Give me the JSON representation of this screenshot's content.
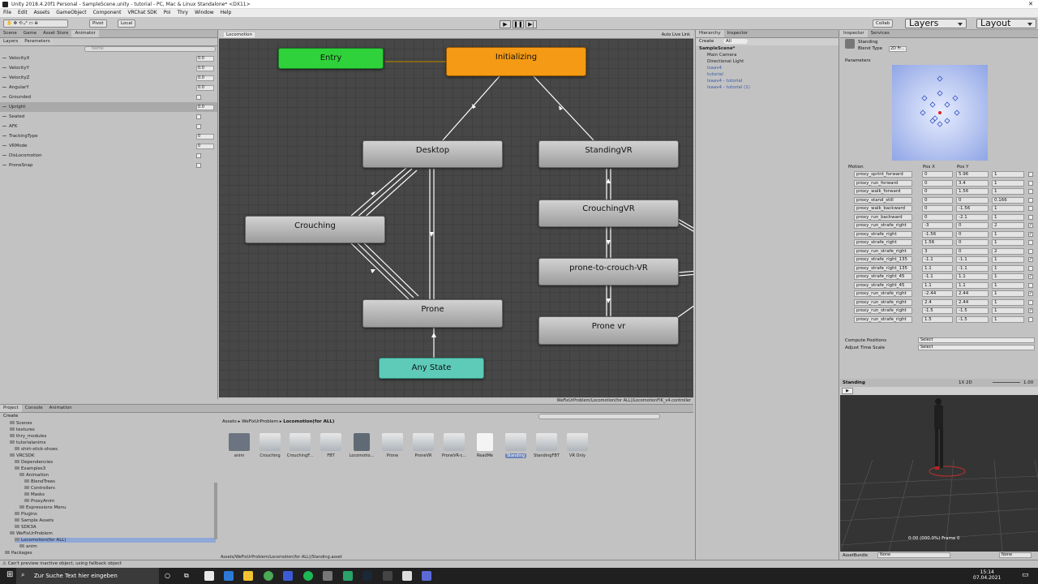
{
  "window": {
    "title": "Unity 2018.4.20f1 Personal - SampleScene.unity - tutorial - PC, Mac & Linux Standalone* <DX11>"
  },
  "menu": [
    "File",
    "Edit",
    "Assets",
    "GameObject",
    "Component",
    "VRChat SDK",
    "Poi",
    "Thry",
    "Window",
    "Help"
  ],
  "toolbar": {
    "pivot": "Pivot",
    "local": "Local",
    "collab": "Collab",
    "layers": "Layers",
    "layout": "Layout"
  },
  "left_tabs": [
    "Scene",
    "Game",
    "Asset Store",
    "Animator"
  ],
  "animator_subtabs": [
    "Layers",
    "Parameters"
  ],
  "search_placeholder": "Name",
  "parameters": [
    {
      "name": "VelocityX",
      "value": "0.0",
      "type": "float"
    },
    {
      "name": "VelocityY",
      "value": "0.0",
      "type": "float"
    },
    {
      "name": "VelocityZ",
      "value": "0.0",
      "type": "float"
    },
    {
      "name": "AngularY",
      "value": "0.0",
      "type": "float"
    },
    {
      "name": "Grounded",
      "value": "",
      "type": "bool"
    },
    {
      "name": "Upright",
      "value": "0.0",
      "type": "float"
    },
    {
      "name": "Seated",
      "value": "",
      "type": "bool"
    },
    {
      "name": "AFK",
      "value": "",
      "type": "bool"
    },
    {
      "name": "TrackingType",
      "value": "0",
      "type": "int"
    },
    {
      "name": "VRMode",
      "value": "0",
      "type": "int"
    },
    {
      "name": "DisLocomotion",
      "value": "",
      "type": "bool"
    },
    {
      "name": "ProneSnap",
      "value": "",
      "type": "bool"
    }
  ],
  "graph": {
    "breadcrumb": "Locomotion",
    "auto_live": "Auto Live Link",
    "path": "WeFixUrProblem/Locomotion(for ALL)/LocomotionFIK_v4.controller",
    "nodes": {
      "entry": "Entry",
      "initializing": "Initializing",
      "desktop": "Desktop",
      "standingvr": "StandingVR",
      "crouching": "Crouching",
      "crouchingvr": "CrouchingVR",
      "prone_to_crouch": "prone-to-crouch-VR",
      "prone": "Prone",
      "prone_vr": "Prone vr",
      "any_state": "Any State"
    }
  },
  "project": {
    "tabs": [
      "Project",
      "Console",
      "Animation"
    ],
    "create": "Create",
    "breadcrumb": [
      "Assets",
      "WeFixUrProblem",
      "Locomotion(for ALL)"
    ],
    "tree": [
      {
        "label": "Scenes",
        "indent": 2
      },
      {
        "label": "textures",
        "indent": 2
      },
      {
        "label": "thry_modules",
        "indent": 2
      },
      {
        "label": "tutorialanims",
        "indent": 2
      },
      {
        "label": "shirt-stick-shoes",
        "indent": 3
      },
      {
        "label": "VRCSDK",
        "indent": 2
      },
      {
        "label": "Dependencies",
        "indent": 3
      },
      {
        "label": "Examples3",
        "indent": 3
      },
      {
        "label": "Animation",
        "indent": 4
      },
      {
        "label": "BlendTrees",
        "indent": 5
      },
      {
        "label": "Controllers",
        "indent": 5
      },
      {
        "label": "Masks",
        "indent": 5
      },
      {
        "label": "ProxyAnim",
        "indent": 5
      },
      {
        "label": "Expressions Menu",
        "indent": 4
      },
      {
        "label": "Plugins",
        "indent": 3
      },
      {
        "label": "Sample Assets",
        "indent": 3
      },
      {
        "label": "SDK3A",
        "indent": 3
      },
      {
        "label": "WeFixUrProblem",
        "indent": 2
      },
      {
        "label": "Locomotion(for ALL)",
        "indent": 3
      },
      {
        "label": "anim",
        "indent": 4
      },
      {
        "label": "Packages",
        "indent": 1
      }
    ],
    "assets": [
      "anim",
      "Crouching",
      "CrouchingF...",
      "FBT",
      "Locomotio...",
      "Prone",
      "ProneVR",
      "ProneVR-c...",
      "ReadMe",
      "Standing",
      "StandingFBT",
      "VR Only"
    ],
    "selected_path": "Assets/WeFixUrProblem/Locomotion(for ALL)/Standing.asset"
  },
  "hierarchy": {
    "tab": "Hierarchy",
    "create": "Create",
    "all": "All",
    "items": [
      {
        "label": "SampleScene*",
        "indent": 0
      },
      {
        "label": "Main Camera",
        "indent": 1
      },
      {
        "label": "Directional Light",
        "indent": 1
      },
      {
        "label": "Isaav4",
        "indent": 1
      },
      {
        "label": "tutorial",
        "indent": 1
      },
      {
        "label": "Isaav4 - tutorial",
        "indent": 1
      },
      {
        "label": "Isaav4 - tutorial (1)",
        "indent": 1
      }
    ]
  },
  "inspector": {
    "top_tab": "Inspector",
    "tabs": [
      "Inspector",
      "Services"
    ],
    "object": "Standing",
    "blend_type_label": "Blend Type",
    "blend_type": "2D Fr...",
    "parameters_label": "Parameters",
    "columns": [
      "Motion",
      "Pos X",
      "Pos Y"
    ],
    "motions": [
      {
        "name": "proxy_sprint_forward",
        "x": "0",
        "y": "5.96",
        "s": "1",
        "c": false
      },
      {
        "name": "proxy_run_forward",
        "x": "0",
        "y": "3.4",
        "s": "1",
        "c": false
      },
      {
        "name": "proxy_walk_forward",
        "x": "0",
        "y": "1.56",
        "s": "1",
        "c": false
      },
      {
        "name": "proxy_stand_still",
        "x": "0",
        "y": "0",
        "s": "0.166",
        "c": false
      },
      {
        "name": "proxy_walk_backward",
        "x": "0",
        "y": "-1.56",
        "s": "1",
        "c": false
      },
      {
        "name": "proxy_run_backward",
        "x": "0",
        "y": "-2.1",
        "s": "1",
        "c": false
      },
      {
        "name": "proxy_run_strafe_right",
        "x": "-3",
        "y": "0",
        "s": "2",
        "c": true
      },
      {
        "name": "proxy_strafe_right",
        "x": "-1.56",
        "y": "0",
        "s": "1",
        "c": true
      },
      {
        "name": "proxy_strafe_right",
        "x": "1.56",
        "y": "0",
        "s": "1",
        "c": false
      },
      {
        "name": "proxy_run_strafe_right",
        "x": "3",
        "y": "0",
        "s": "2",
        "c": false
      },
      {
        "name": "proxy_strafe_right_135",
        "x": "-1.1",
        "y": "-1.1",
        "s": "1",
        "c": true
      },
      {
        "name": "proxy_strafe_right_135",
        "x": "1.1",
        "y": "-1.1",
        "s": "1",
        "c": false
      },
      {
        "name": "proxy_strafe_right_45",
        "x": "-1.1",
        "y": "1.1",
        "s": "1",
        "c": true
      },
      {
        "name": "proxy_strafe_right_45",
        "x": "1.1",
        "y": "1.1",
        "s": "1",
        "c": false
      },
      {
        "name": "proxy_run_strafe_right",
        "x": "-2.44",
        "y": "2.44",
        "s": "1",
        "c": true
      },
      {
        "name": "proxy_run_strafe_right",
        "x": "2.4",
        "y": "2.44",
        "s": "1",
        "c": false
      },
      {
        "name": "proxy_run_strafe_right",
        "x": "-1.5",
        "y": "-1.5",
        "s": "1",
        "c": true
      },
      {
        "name": "proxy_run_strafe_right",
        "x": "1.5",
        "y": "-1.5",
        "s": "1",
        "c": false
      }
    ],
    "compute_positions": "Compute Positions",
    "adjust_time_scale": "Adjust Time Scale",
    "select": "Select"
  },
  "preview": {
    "title": "Standing",
    "mode": "1X 2D",
    "speed": "1.00",
    "frame": "0:00 (000.0%) Frame 0",
    "asset_bundle": "AssetBundle",
    "none": "None"
  },
  "status": {
    "message": "Can't preview inactive object, using fallback object"
  },
  "taskbar": {
    "search_placeholder": "Zur Suche Text hier eingeben",
    "time": "15:14",
    "date": "07.04.2021"
  }
}
